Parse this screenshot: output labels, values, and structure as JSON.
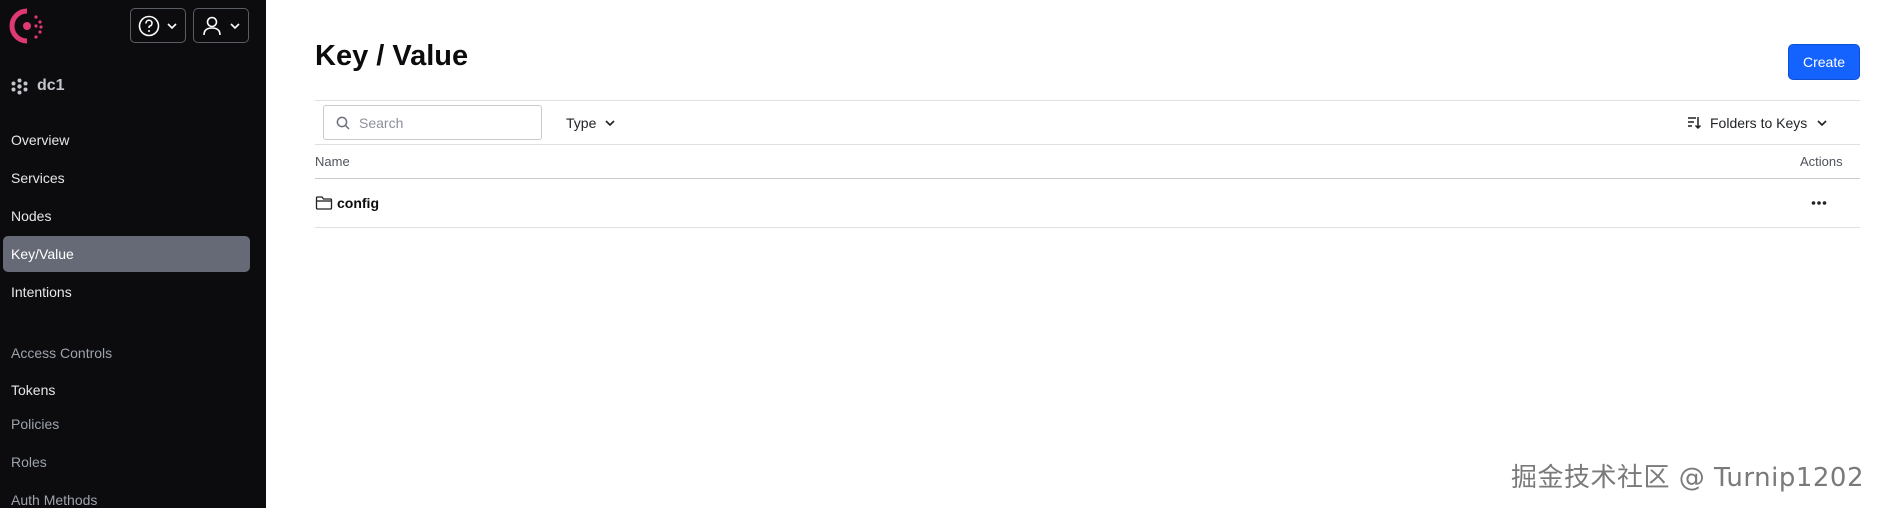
{
  "sidebar": {
    "logo_icon": "consul-logo",
    "help_icon": "question-circle-icon",
    "user_icon": "user-icon",
    "datacenter": {
      "icon": "datacenter-icon",
      "name": "dc1"
    },
    "nav": [
      {
        "label": "Overview"
      },
      {
        "label": "Services"
      },
      {
        "label": "Nodes"
      },
      {
        "label": "Key/Value",
        "active": true
      },
      {
        "label": "Intentions"
      }
    ],
    "access_controls": {
      "heading": "Access Controls",
      "items": [
        {
          "label": "Tokens"
        },
        {
          "label": "Policies"
        },
        {
          "label": "Roles"
        },
        {
          "label": "Auth Methods"
        }
      ]
    }
  },
  "main": {
    "title": "Key / Value",
    "create_label": "Create",
    "search_placeholder": "Search",
    "type_filter_label": "Type",
    "sort_label": "Folders to Keys",
    "columns": {
      "name": "Name",
      "actions": "Actions"
    },
    "rows": [
      {
        "icon": "folder-icon",
        "name": "config"
      }
    ]
  },
  "watermark": "掘金技术社区 @ Turnip1202",
  "colors": {
    "sidebar_bg": "#0c0c0e",
    "active_nav_bg": "#656a76",
    "primary": "#1563ff",
    "logo": "#e03875"
  }
}
